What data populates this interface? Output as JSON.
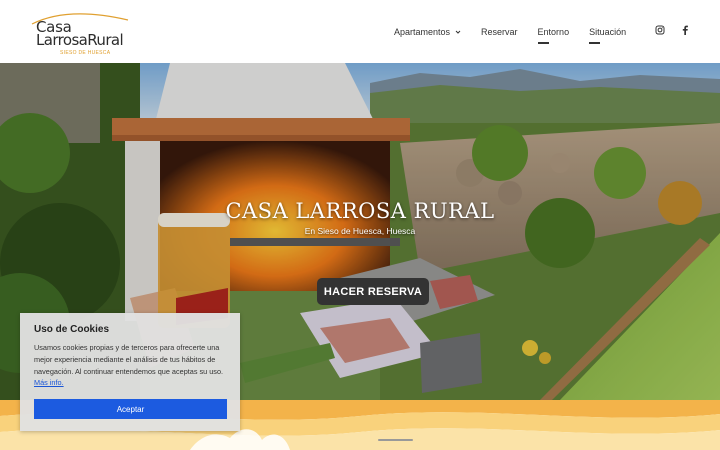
{
  "header": {
    "logo": {
      "line1": "Casa",
      "line2": "LarrosaRural",
      "tagline": "SIESO DE HUESCA"
    },
    "nav": [
      {
        "label": "Apartamentos",
        "dropdown": true
      },
      {
        "label": "Reservar",
        "dropdown": false
      },
      {
        "label": "Entorno",
        "dropdown": false
      },
      {
        "label": "Situación",
        "dropdown": false
      }
    ],
    "social": [
      "instagram-icon",
      "facebook-icon"
    ]
  },
  "hero": {
    "title": "CASA LARROSA RURAL",
    "subtitle": "En Sieso de Huesca, Huesca",
    "cta": "HACER RESERVA"
  },
  "cookie": {
    "title": "Uso de Cookies",
    "text": "Usamos cookies propias y de terceros para ofrecerte una mejor experiencia mediante el análisis de tus hábitos de navegación. Al continuar entendemos que aceptas su uso.",
    "link": "Más info.",
    "button": "Aceptar"
  },
  "colors": {
    "accent_blue": "#1c5be0",
    "button_dark": "#333333",
    "band_orange": "#f3b34a",
    "band_light": "#f9d27c"
  }
}
